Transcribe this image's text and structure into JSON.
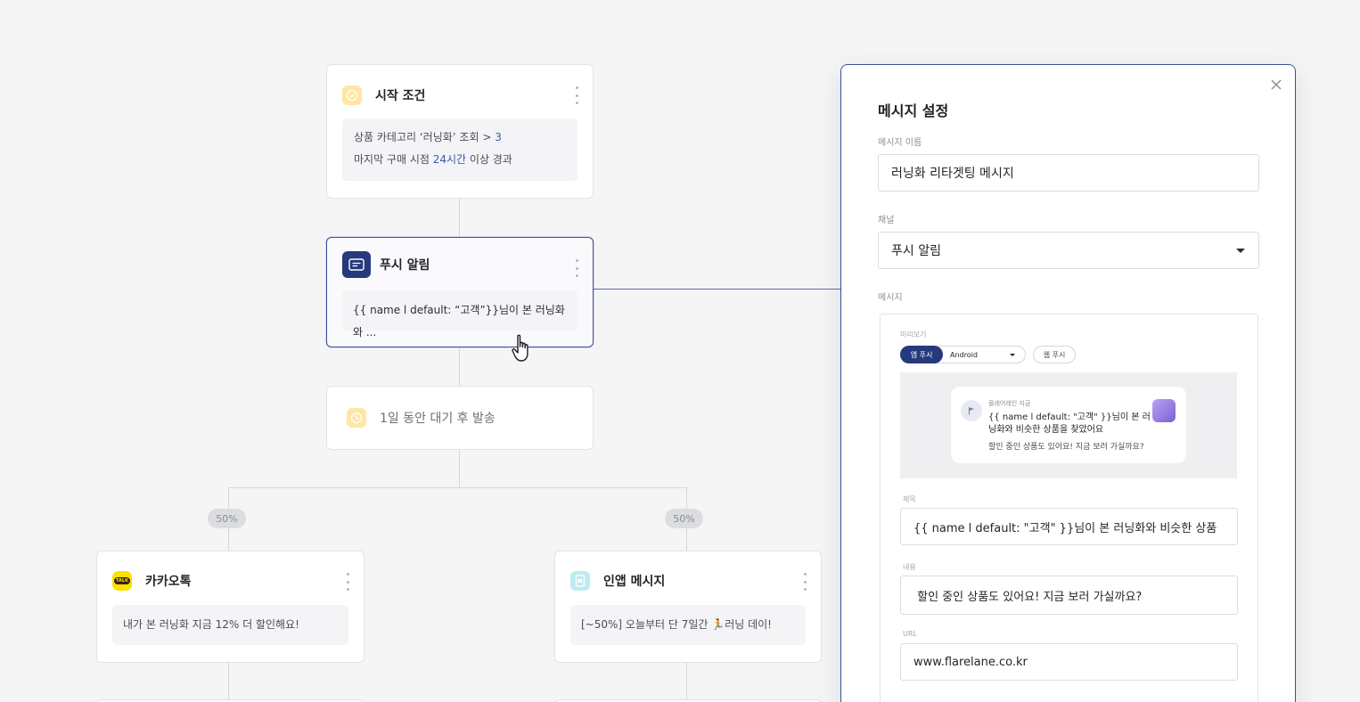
{
  "nodes": {
    "start": {
      "title": "시작 조건",
      "line1_prefix": "상품 카테고리  ‘러닝화’ 조회 > ",
      "line1_value": "3",
      "line2_prefix": "마지막 구매 시점 ",
      "line2_value": "24시간",
      "line2_suffix": " 이상 경과",
      "icon": "check-circle-icon",
      "icon_color": "#f7cf5a"
    },
    "push": {
      "title": "푸시 알림",
      "body": "{{ name l default: “고객”}}님이 본 러닝화와 ...",
      "icon": "push-message-icon",
      "icon_color": "#26397c"
    },
    "wait": {
      "title": "1일 동안 대기 후 발송",
      "icon": "clock-icon",
      "icon_color": "#f7cf5a"
    },
    "kakao": {
      "title": "카카오톡",
      "body": "내가 본 러닝화 지금 12% 더 할인해요!",
      "icon": "kakaotalk-icon",
      "icon_color": "#fae100",
      "icon_text": "TALK"
    },
    "inapp": {
      "title": "인앱 메시지",
      "body": "[~50%] 오늘부터 단 7일간 🏃러닝 데이!",
      "icon": "in-app-message-icon",
      "icon_color": "#a6e4ee"
    }
  },
  "split": {
    "left": "50%",
    "right": "50%"
  },
  "panel": {
    "title": "메시지 설정",
    "name_label": "메시지 이름",
    "name_value": "러닝화 리타겟팅 메시지",
    "channel_label": "채널",
    "channel_value": "푸시 알림",
    "message_label": "메시지",
    "preview": {
      "label": "미리보기",
      "tab_app": "앱 푸시",
      "os_value": "Android",
      "tab_web": "웹 푸시",
      "notif_app": "플레어레인 지금",
      "notif_title": "{{ name l default: \"고객\" }}님이 본 러닝화와 비슷한 상품을 찾았어요",
      "notif_body": "할인 중인 상품도 있어요! 지금 보러 가실까요?"
    },
    "title_label": "제목",
    "title_value": "{{ name l default: \"고객\" }}님이 본 러닝화와 비슷한 상품",
    "content_label": "내용",
    "content_value": " 할인 중인 상품도 있어요! 지금 보러 가실까요?",
    "url_label": "URL",
    "url_value": "www.flarelane.co.kr"
  },
  "colors": {
    "accent": "#26397c",
    "highlight": "#3b58a8",
    "background": "#f5f5f6"
  }
}
